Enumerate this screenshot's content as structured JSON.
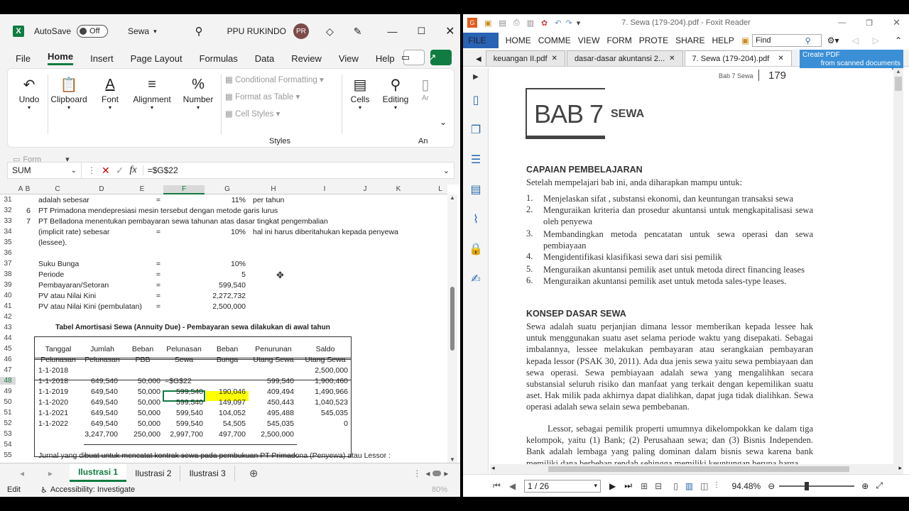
{
  "excel": {
    "autosave_label": "AutoSave",
    "autosave_state": "Off",
    "file_name": "Sewa",
    "user_name": "PPU RUKINDO",
    "user_initials": "PR",
    "menu": [
      "File",
      "Home",
      "Insert",
      "Page Layout",
      "Formulas",
      "Data",
      "Review",
      "View",
      "Help"
    ],
    "ribbon": {
      "undo": "Undo",
      "clipboard": "Clipboard",
      "font": "Font",
      "alignment": "Alignment",
      "number": "Number",
      "conditional_formatting": "Conditional Formatting",
      "format_as_table": "Format as Table",
      "cell_styles": "Cell Styles",
      "styles_group": "Styles",
      "cells": "Cells",
      "editing": "Editing",
      "an": "An",
      "ar": "Ar",
      "form": "Form"
    },
    "name_box": "SUM",
    "formula": "=$G$22",
    "columns": [
      "A",
      "B",
      "C",
      "D",
      "E",
      "F",
      "G",
      "H",
      "I",
      "J",
      "K",
      "L"
    ],
    "rows": {
      "r31": {
        "n": "31",
        "c": "adalah sebesar",
        "e": "=",
        "g": "11%",
        "h": "per tahun"
      },
      "r32": {
        "n": "32",
        "b": "6",
        "c": "PT Primadona mendepresiasi mesin tersebut dengan metode garis lurus"
      },
      "r33": {
        "n": "33",
        "b": "7",
        "c": "PT Belladona menentukan pembayaran sewa tahunan atas dasar tingkat pengembalian"
      },
      "r34": {
        "n": "34",
        "c": "(implicit rate) sebesar",
        "e": "=",
        "g": "10%",
        "h": "hal ini harus diberitahukan kepada penyewa"
      },
      "r35": {
        "n": "35",
        "c": "(lessee)."
      },
      "r36": {
        "n": "36"
      },
      "r37": {
        "n": "37",
        "c": "Suku Bunga",
        "e": "=",
        "g": "10%"
      },
      "r38": {
        "n": "38",
        "c": "Periode",
        "e": "=",
        "g": "5"
      },
      "r39": {
        "n": "39",
        "c": "Pembayaran/Setoran",
        "e": "=",
        "g": "599,540"
      },
      "r40": {
        "n": "40",
        "c": "PV atau Nilai Kini",
        "e": "=",
        "g": "2,272,732"
      },
      "r41": {
        "n": "41",
        "c": "PV atau Nilai Kini (pembulatan)",
        "e": "=",
        "g": "2,500,000"
      },
      "r42": {
        "n": "42"
      },
      "r43": {
        "n": "43",
        "title": "Tabel Amortisasi Sewa (Annuity Due) - Pembayaran sewa dilakukan di awal tahun"
      },
      "r44": {
        "n": "44"
      },
      "r45": {
        "n": "45"
      },
      "r46": {
        "n": "46"
      },
      "r47": {
        "n": "47",
        "c": "1-1-2018",
        "i": "2,500,000"
      },
      "r48": {
        "n": "48",
        "c": "1-1-2018",
        "d": "649,540",
        "e": "50,000",
        "f": "=$G$22",
        "h": "599,540",
        "i": "1,900,460"
      },
      "r49": {
        "n": "49",
        "c": "1-1-2019",
        "d": "649,540",
        "e": "50,000",
        "f": "599,540",
        "g": "190,046",
        "h": "409,494",
        "i": "1,490,966"
      },
      "r50": {
        "n": "50",
        "c": "1-1-2020",
        "d": "649,540",
        "e": "50,000",
        "f": "599,540",
        "g": "149,097",
        "h": "450,443",
        "i": "1,040,523"
      },
      "r51": {
        "n": "51",
        "c": "1-1-2021",
        "d": "649,540",
        "e": "50,000",
        "f": "599,540",
        "g": "104,052",
        "h": "495,488",
        "i": "545,035"
      },
      "r52": {
        "n": "52",
        "c": "1-1-2022",
        "d": "649,540",
        "e": "50,000",
        "f": "599,540",
        "g": "54,505",
        "h": "545,035",
        "i": "0"
      },
      "r53": {
        "n": "53",
        "d": "3,247,700",
        "e": "250,000",
        "f": "2,997,700",
        "g": "497,700",
        "h": "2,500,000"
      },
      "r54": {
        "n": "54"
      },
      "r55": {
        "n": "55",
        "c": "Jurnal yang dibuat untuk mencatat kontrak sewa pada pembukuan PT Primadona (Penyewa) atau Lessor :"
      }
    },
    "table_headers": {
      "h1": [
        "Tanggal",
        "Jumlah",
        "Beban",
        "Pelunasan",
        "Beban",
        "Penurunan",
        "Saldo"
      ],
      "h2": [
        "Pelunasan",
        "Pelunasan",
        "PBB",
        "Sewa",
        "Bunga",
        "Utang Sewa",
        "Utang Sewa"
      ]
    },
    "sheets": [
      "Ilustrasi 1",
      "Ilustrasi 2",
      "Ilustrasi 3"
    ],
    "status_mode": "Edit",
    "accessibility": "Accessibility: Investigate",
    "zoom": "80%"
  },
  "foxit": {
    "window_title": "7. Sewa (179-204).pdf - Foxit Reader",
    "menu": [
      "FILE",
      "HOME",
      "COMME",
      "VIEW",
      "FORM",
      "PROTE",
      "SHARE",
      "HELP"
    ],
    "search_placeholder": "Find",
    "tabs": [
      "keuangan II.pdf",
      "dasar-dasar akuntansi 2...",
      "7. Sewa (179-204).pdf"
    ],
    "create_pdf_1": "Create PDF",
    "create_pdf_2": "from scanned documents",
    "page_header": "Bab 7 Sewa",
    "page_number": "179",
    "bab": "BAB 7",
    "bab_title": "SEWA",
    "capaian_heading": "CAPAIAN PEMBELAJARAN",
    "capaian_intro": "Setelah mempelajari bab ini, anda diharapkan mampu untuk:",
    "objectives": [
      {
        "n": "1.",
        "t": "Menjelaskan sifat , substansi ekonomi, dan keuntungan transaksi sewa"
      },
      {
        "n": "2.",
        "t": "Menguraikan kriteria dan prosedur akuntansi untuk mengkapitalisasi sewa oleh penyewa"
      },
      {
        "n": "3.",
        "t": "Membandingkan metoda pencatatan untuk sewa operasi dan sewa pembiayaan"
      },
      {
        "n": "4.",
        "t": "Mengidentifikasi klasifikasi sewa dari sisi pemilik"
      },
      {
        "n": "5.",
        "t": "Menguraikan akuntansi pemilik aset untuk metoda direct financing leases"
      },
      {
        "n": "6.",
        "t": "Menguraikan akuntansi pemilik aset untuk metoda sales-type leases."
      }
    ],
    "konsep_heading": "KONSEP DASAR SEWA",
    "para1": "Sewa adalah suatu perjanjian dimana lessor memberikan kepada lessee hak untuk menggunakan suatu aset selama periode waktu yang disepakati. Sebagai imbalannya, lessee melakukan pembayaran atau serangkaian pembayaran kepada lessor (PSAK 30, 2011). Ada dua jenis sewa yaitu sewa pembiayaan dan sewa operasi. Sewa pembiayaan adalah sewa yang mengalihkan secara substansial seluruh risiko dan manfaat yang terkait dengan kepemilikan suatu aset. Hak milik pada akhirnya dapat dialihkan, dapat juga tidak dialihkan. Sewa operasi adalah sewa selain sewa pembebanan.",
    "para2": "Lessor, sebagai pemilik properti umumnya dikelompokkan ke dalam tiga kelompok, yaitu (1) Bank; (2) Perusahaan sewa; dan (3) Bisnis Independen. Bank adalah lembaga yang paling dominan dalam bisnis sewa karena bank memiliki dana berbeban rendah sehingga memiliki keuntungan berupa harga",
    "page_field": "1 / 26",
    "zoom": "94.48%"
  }
}
